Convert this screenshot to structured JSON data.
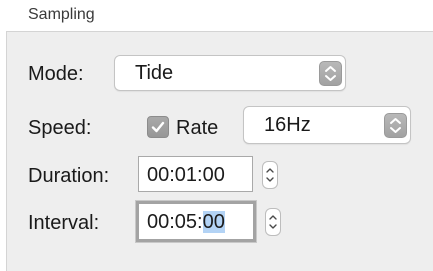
{
  "group": {
    "title": "Sampling"
  },
  "mode": {
    "label": "Mode:",
    "value": "Tide"
  },
  "speed": {
    "label": "Speed:",
    "checkbox_label": "Rate",
    "checked": true,
    "rate_value": "16Hz"
  },
  "duration": {
    "label": "Duration:",
    "value": "00:01:00"
  },
  "interval": {
    "label": "Interval:",
    "value_prefix": "00:05:",
    "value_selected": "00"
  },
  "icons": {
    "popup_arrows": "chevron-up-down-icon",
    "checkmark": "checkmark-icon",
    "stepper": "stepper-up-down-icon"
  }
}
